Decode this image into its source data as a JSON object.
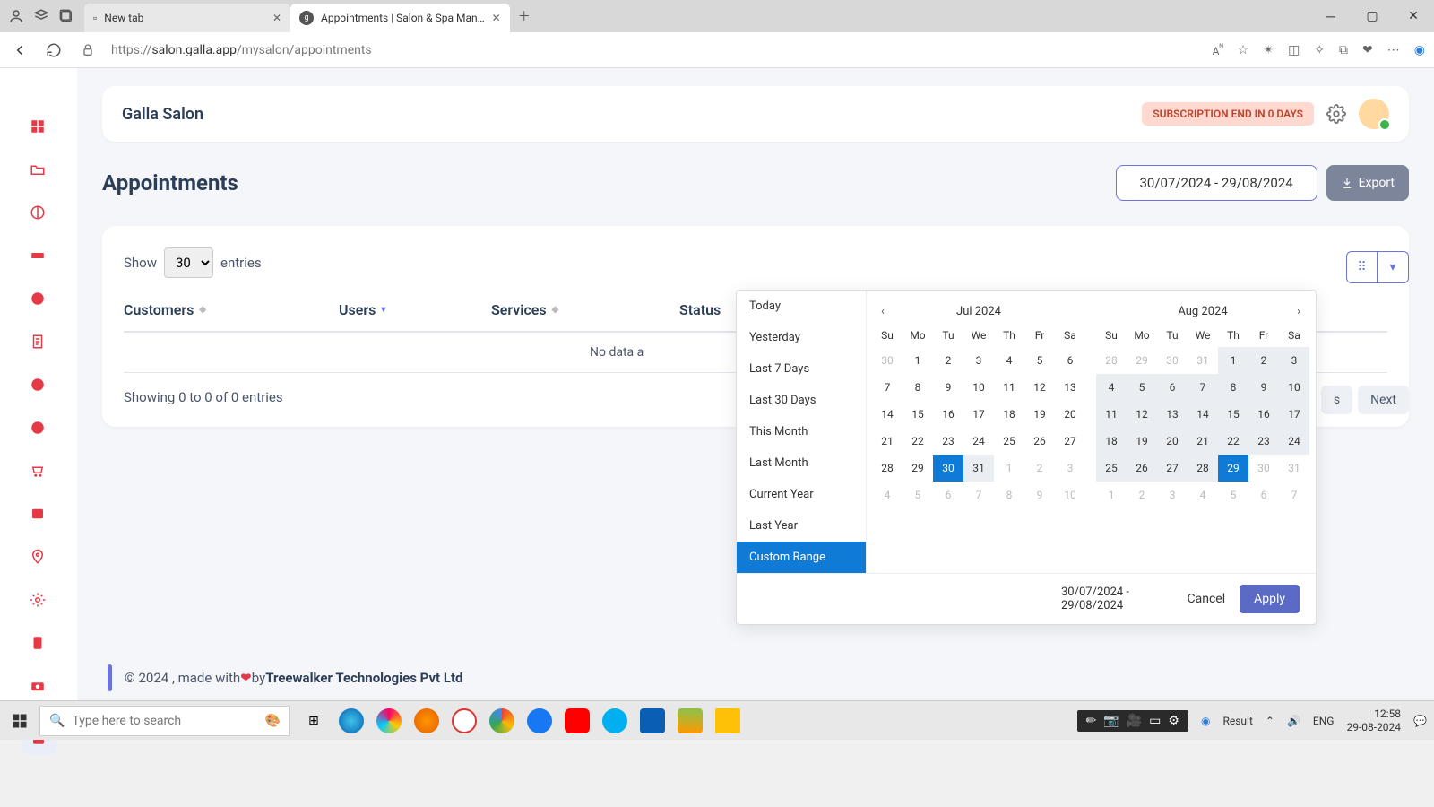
{
  "browser": {
    "tabs": [
      {
        "title": "New tab"
      },
      {
        "title": "Appointments | Salon & Spa Man…"
      }
    ],
    "url_prefix": "https://",
    "url_host": "salon.galla.app",
    "url_path": "/mysalon/appointments"
  },
  "header": {
    "brand": "Galla Salon",
    "sub_badge": "SUBSCRIPTION END IN 0 DAYS"
  },
  "page": {
    "title": "Appointments",
    "date_range": "30/07/2024 - 29/08/2024",
    "export": "Export",
    "show": "Show",
    "show_value": "30",
    "entries": "entries",
    "columns": [
      "Customers",
      "Users",
      "Services",
      "Status"
    ],
    "nodata": "No data a",
    "showing": "Showing 0 to 0 of 0 entries",
    "pager_prev": "s",
    "pager_next": "Next"
  },
  "picker": {
    "presets": [
      "Today",
      "Yesterday",
      "Last 7 Days",
      "Last 30 Days",
      "This Month",
      "Last Month",
      "Current Year",
      "Last Year",
      "Custom Range"
    ],
    "selected_preset": 8,
    "months": [
      "Jul 2024",
      "Aug 2024"
    ],
    "dow": [
      "Su",
      "Mo",
      "Tu",
      "We",
      "Th",
      "Fr",
      "Sa"
    ],
    "footer_range": "30/07/2024 - 29/08/2024",
    "cancel": "Cancel",
    "apply": "Apply"
  },
  "footer": {
    "pre": "© 2024 , made with ",
    "by": " by ",
    "company": "Treewalker Technologies Pvt Ltd"
  },
  "taskbar": {
    "search_placeholder": "Type here to search",
    "result": "Result",
    "lang": "ENG",
    "time": "12:58",
    "date": "29-08-2024"
  }
}
